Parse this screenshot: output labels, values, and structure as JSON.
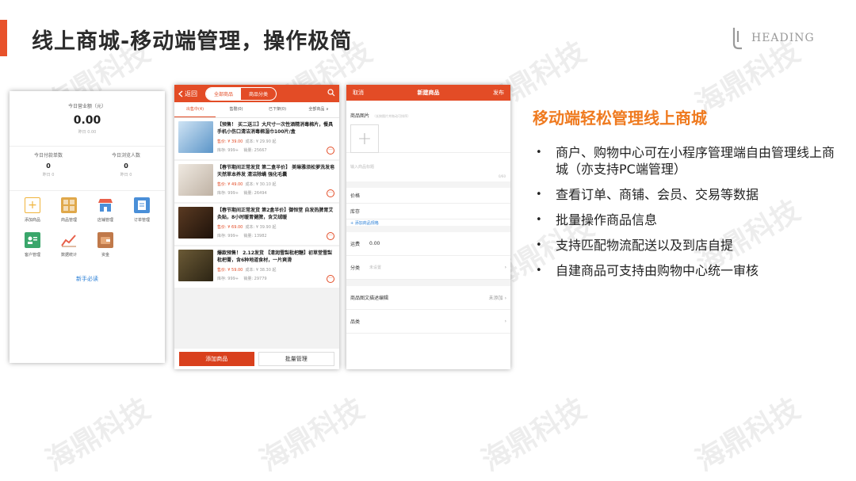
{
  "slide": {
    "title": "线上商城-移动端管理，操作极简",
    "logo_text": "HEADING",
    "watermark": "海鼎科技"
  },
  "panel_home": {
    "revenue_label": "今日营业额（元）",
    "revenue_value": "0.00",
    "revenue_yesterday": "昨日 0.00",
    "stats": [
      {
        "label": "今日付款单数",
        "value": "0",
        "yesterday": "昨日 0"
      },
      {
        "label": "今日浏览人数",
        "value": "0",
        "yesterday": "昨日 0"
      }
    ],
    "grid": [
      {
        "label": "添加商品",
        "icon": "add-product-icon",
        "color": "#f0b43c"
      },
      {
        "label": "商品管理",
        "icon": "product-manage-icon",
        "color": "#e0a84a"
      },
      {
        "label": "店铺管理",
        "icon": "store-icon",
        "color": "#e8604a"
      },
      {
        "label": "订单管理",
        "icon": "order-icon",
        "color": "#4a8fd8"
      },
      {
        "label": "客户管理",
        "icon": "customer-icon",
        "color": "#3aa66b"
      },
      {
        "label": "数据统计",
        "icon": "chart-icon",
        "color": "#e8604a"
      },
      {
        "label": "资金",
        "icon": "wallet-icon",
        "color": "#c0794a"
      }
    ],
    "guide_link": "新手必读"
  },
  "panel_products": {
    "back_label": "返回",
    "segments": [
      "全部商品",
      "商品分类"
    ],
    "tabs": [
      "出售中(4)",
      "售罄(0)",
      "已下架(0)",
      "全部商品 ∨"
    ],
    "products": [
      {
        "title": "【预售！ 买二送三】大尺寸一次性酒精消毒棉片，餐具手机小伤口清洁消毒棉湿巾100片/盒",
        "price": "售价: ¥ 39.00",
        "cost": "成本: ¥ 29.90 起",
        "stock": "库存: 999+",
        "sales": "销量: 25667",
        "image_color": "#5b95c8"
      },
      {
        "title": "【春节期间正常发货 第二盒半价】 美琳雅须松萝洗发皂 天然草本养发 清洁除螨 强化毛囊",
        "price": "售价: ¥ 49.00",
        "cost": "成本: ¥ 30.10 起",
        "stock": "库存: 999+",
        "sales": "销量: 26494",
        "image_color": "#d8d2ca"
      },
      {
        "title": "【春节期间正常发货 第2盒半价】御恒堂 自发热脾胃艾灸贴，8小时暖胃健脾，含艾绒暖",
        "price": "售价: ¥ 69.00",
        "cost": "成本: ¥ 39.90 起",
        "stock": "库存: 999+",
        "sales": "销量: 13982",
        "image_color": "#3a2418"
      },
      {
        "title": "爆款预售！ 2.12发货 【清润雪梨枇杷糖】初草堂雪梨枇杷膏，含6种地道食材，一片爽滑",
        "price": "售价: ¥ 59.00",
        "cost": "成本: ¥ 38.30 起",
        "stock": "库存: 999+",
        "sales": "销量: 29779",
        "image_color": "#4a3a22"
      }
    ],
    "add_button": "添加商品",
    "batch_button": "批量管理"
  },
  "panel_new": {
    "cancel": "取消",
    "title": "新建商品",
    "publish": "发布",
    "image_label": "商品图片",
    "image_hint": "（长按图片并拖动可排序）",
    "title_placeholder": "输入商品标题",
    "title_count": "0/60",
    "price_label": "价格",
    "stock_label": "库存",
    "add_spec": "+ 添加商品规格",
    "freight_label": "运费",
    "freight_value": "0.00",
    "category_label": "分类",
    "category_placeholder": "未设置",
    "desc_label": "商品图文描述编辑",
    "desc_status": "未添加",
    "type_label": "品类"
  },
  "right": {
    "heading": "移动端轻松管理线上商城",
    "bullets": [
      "商户、购物中心可在小程序管理端自由管理线上商城（亦支持PC端管理）",
      "查看订单、商铺、会员、交易等数据",
      "批量操作商品信息",
      "支持匹配物流配送以及到店自提",
      "自建商品可支持由购物中心统一审核"
    ]
  },
  "colors": {
    "accent": "#e8522b",
    "app_red": "#e34c26",
    "orange": "#ef7a1f"
  }
}
